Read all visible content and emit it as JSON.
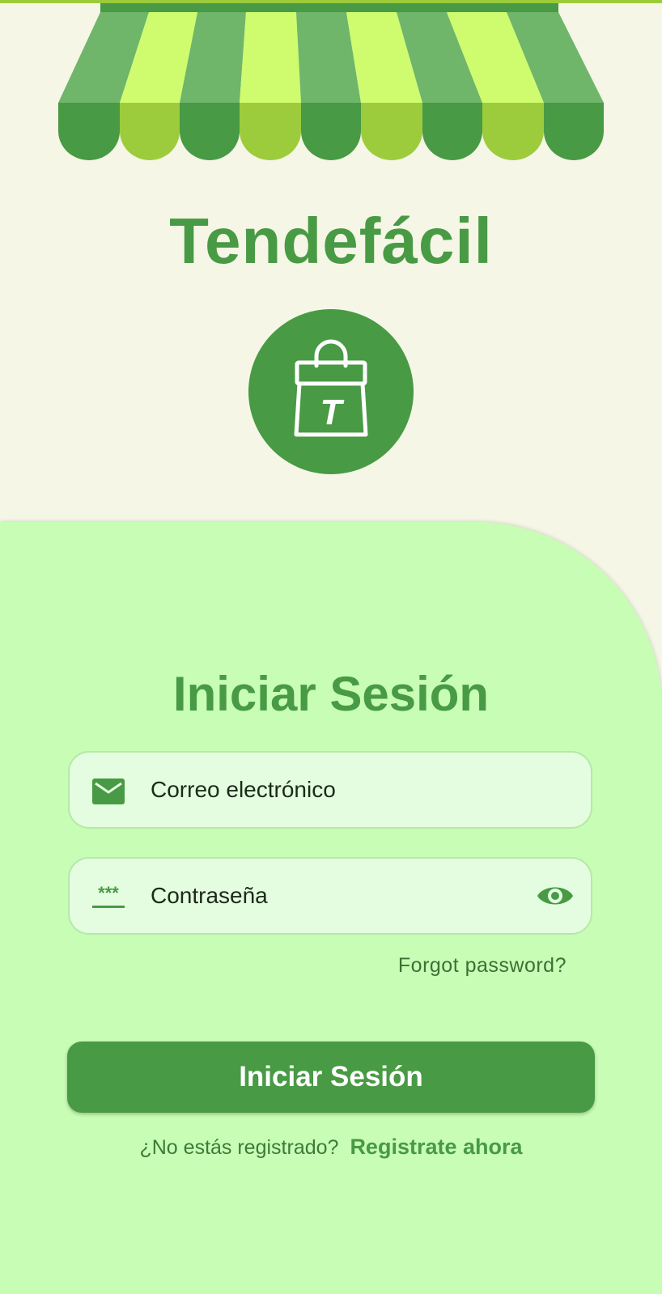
{
  "app": {
    "title": "Tendefácil",
    "logo_letter": "T"
  },
  "login": {
    "title": "Iniciar Sesión",
    "email_placeholder": "Correo electrónico",
    "password_placeholder": "Contraseña",
    "password_icon_text": "***",
    "forgot_label": "Forgot password?",
    "submit_label": "Iniciar Sesión",
    "register_question": "¿No estás registrado?",
    "register_link": "Registrate ahora"
  },
  "icons": {
    "logo": "shopping-bag-icon",
    "email": "mail-icon",
    "password": "password-icon",
    "toggle": "eye-icon"
  },
  "colors": {
    "primary": "#489a44",
    "panel": "#c8fdb6",
    "background": "#f5f6e6",
    "awning_dark": "#489a44",
    "awning_light": "#9ccc3c",
    "awning_stripe_dark": "#6fb56a",
    "awning_stripe_light": "#cefc6e"
  }
}
